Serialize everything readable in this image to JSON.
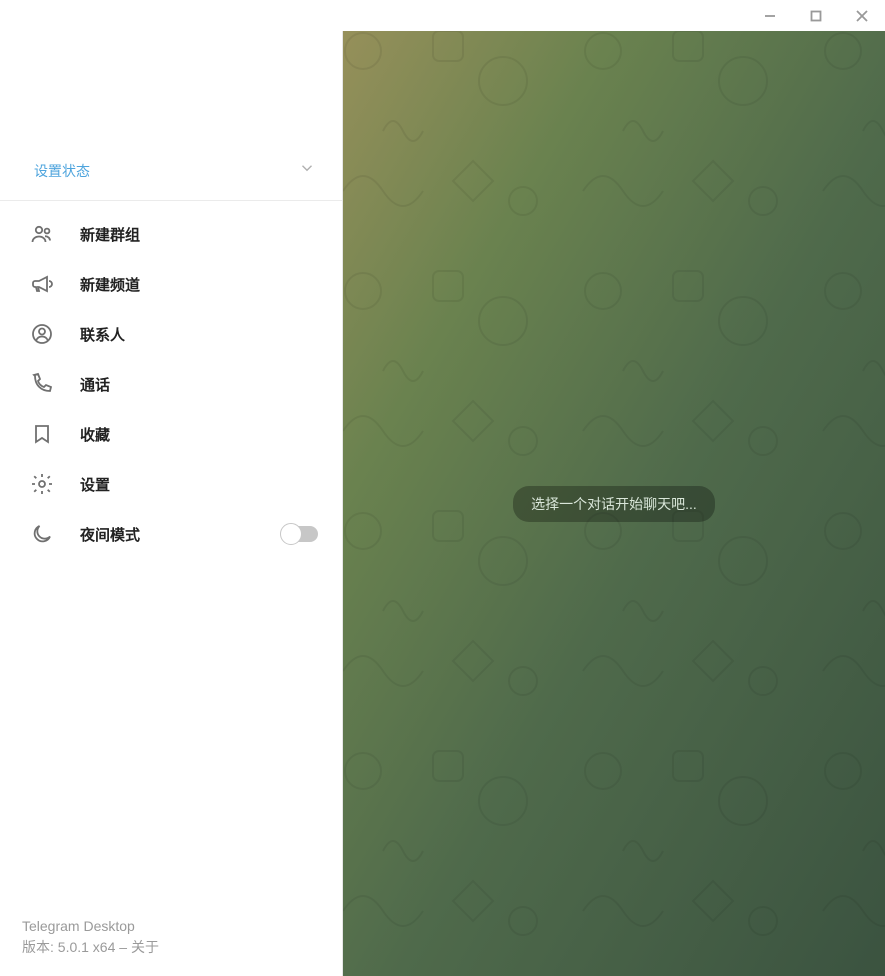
{
  "status": {
    "set_status": "设置状态"
  },
  "menu": {
    "new_group": "新建群组",
    "new_channel": "新建频道",
    "contacts": "联系人",
    "calls": "通话",
    "saved": "收藏",
    "settings": "设置",
    "night_mode": "夜间模式"
  },
  "footer": {
    "app_name": "Telegram Desktop",
    "version_prefix": "版本: ",
    "version": "5.0.1 x64",
    "separator": " – ",
    "about": "关于"
  },
  "main": {
    "empty_hint": "选择一个对话开始聊天吧..."
  }
}
